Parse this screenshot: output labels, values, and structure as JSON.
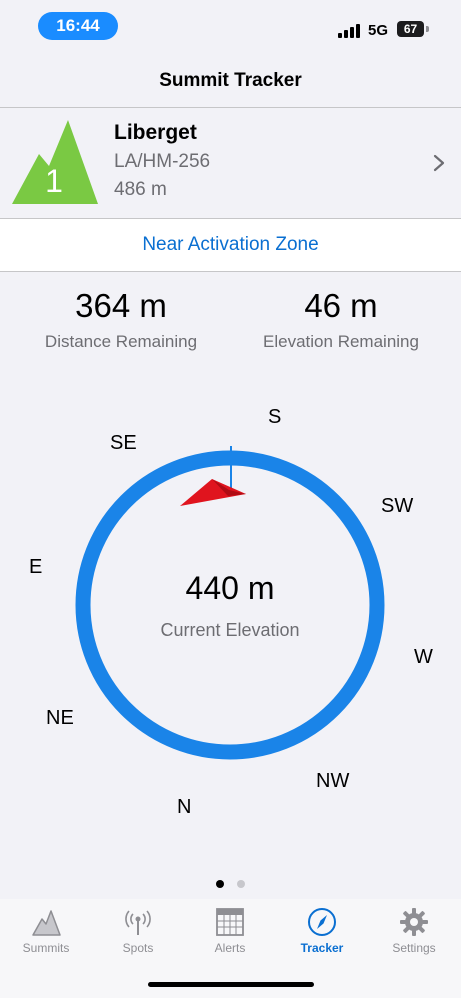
{
  "status_bar": {
    "time": "16:44",
    "network": "5G",
    "battery": "67"
  },
  "nav": {
    "title": "Summit Tracker"
  },
  "summit": {
    "badge": "1",
    "name": "Liberget",
    "reference": "LA/HM-256",
    "height": "486 m",
    "badge_color": "#7ac943"
  },
  "zone_banner": {
    "text": "Near Activation Zone",
    "color": "#0a6fd1"
  },
  "stats": {
    "distance": {
      "value": "364 m",
      "label": "Distance Remaining"
    },
    "elevation": {
      "value": "46 m",
      "label": "Elevation Remaining"
    }
  },
  "compass": {
    "directions": {
      "s": "S",
      "se": "SE",
      "sw": "SW",
      "e": "E",
      "w": "W",
      "ne": "NE",
      "nw": "NW",
      "n": "N"
    },
    "current_elevation_value": "440 m",
    "current_elevation_label": "Current Elevation",
    "ring_color": "#1a84e8",
    "pointer_color": "#e0141e"
  },
  "pager": {
    "pages": 2,
    "current": 1
  },
  "tabs": [
    {
      "label": "Summits",
      "icon": "mountain-icon",
      "active": false
    },
    {
      "label": "Spots",
      "icon": "antenna-icon",
      "active": false
    },
    {
      "label": "Alerts",
      "icon": "calendar-icon",
      "active": false
    },
    {
      "label": "Tracker",
      "icon": "compass-icon",
      "active": true
    },
    {
      "label": "Settings",
      "icon": "gear-icon",
      "active": false
    }
  ]
}
